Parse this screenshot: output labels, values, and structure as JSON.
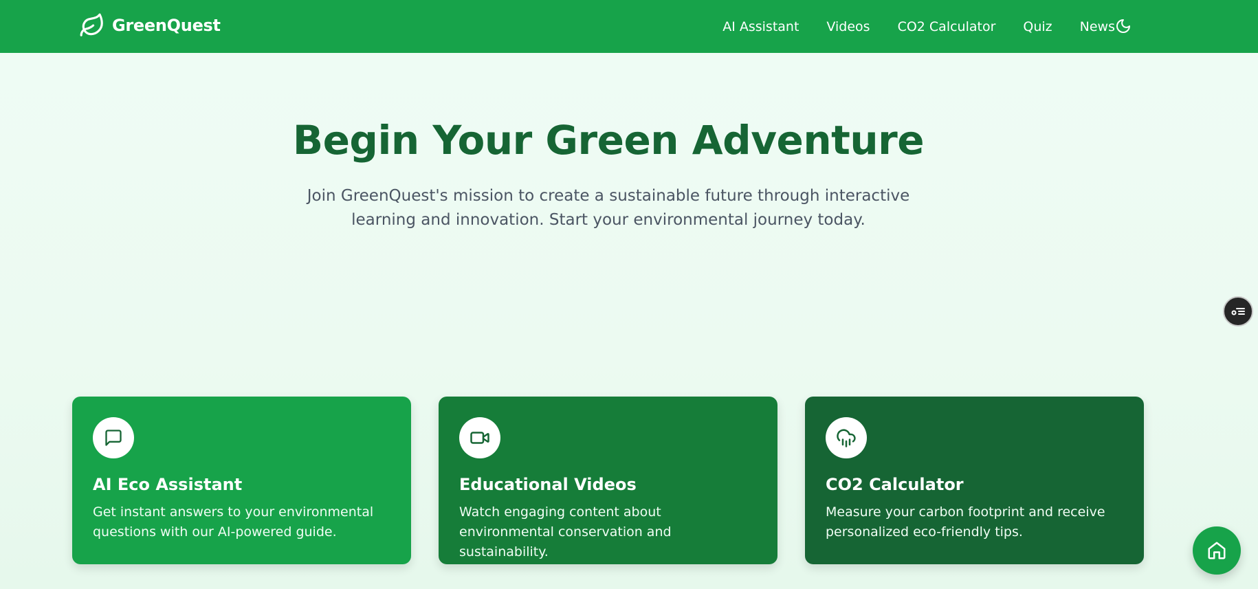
{
  "nav": {
    "brand": "GreenQuest",
    "links": [
      "AI Assistant",
      "Videos",
      "CO2 Calculator",
      "Quiz",
      "News"
    ],
    "theme_icon": "moon-icon"
  },
  "hero": {
    "title": "Begin Your Green Adventure",
    "subtitle": "Join GreenQuest's mission to create a sustainable future through interactive learning and innovation. Start your environmental journey today."
  },
  "cards": [
    {
      "icon": "chat-icon",
      "title": "AI Eco Assistant",
      "description": "Get instant answers to your environmental questions with our AI-powered guide.",
      "color": "#17a34a"
    },
    {
      "icon": "video-camera-icon",
      "title": "Educational Videos",
      "description": "Watch engaging content about environmental conservation and sustainability.",
      "color": "#167d39"
    },
    {
      "icon": "cloud-rain-icon",
      "title": "CO2 Calculator",
      "description": "Measure your carbon footprint and receive personalized eco-friendly tips.",
      "color": "#166534"
    }
  ],
  "colors": {
    "primary": "#17a34a",
    "dark": "#166534",
    "background": "#effcf5"
  },
  "floating": {
    "side_icon": "settings-list-icon",
    "home_icon": "home-icon"
  }
}
